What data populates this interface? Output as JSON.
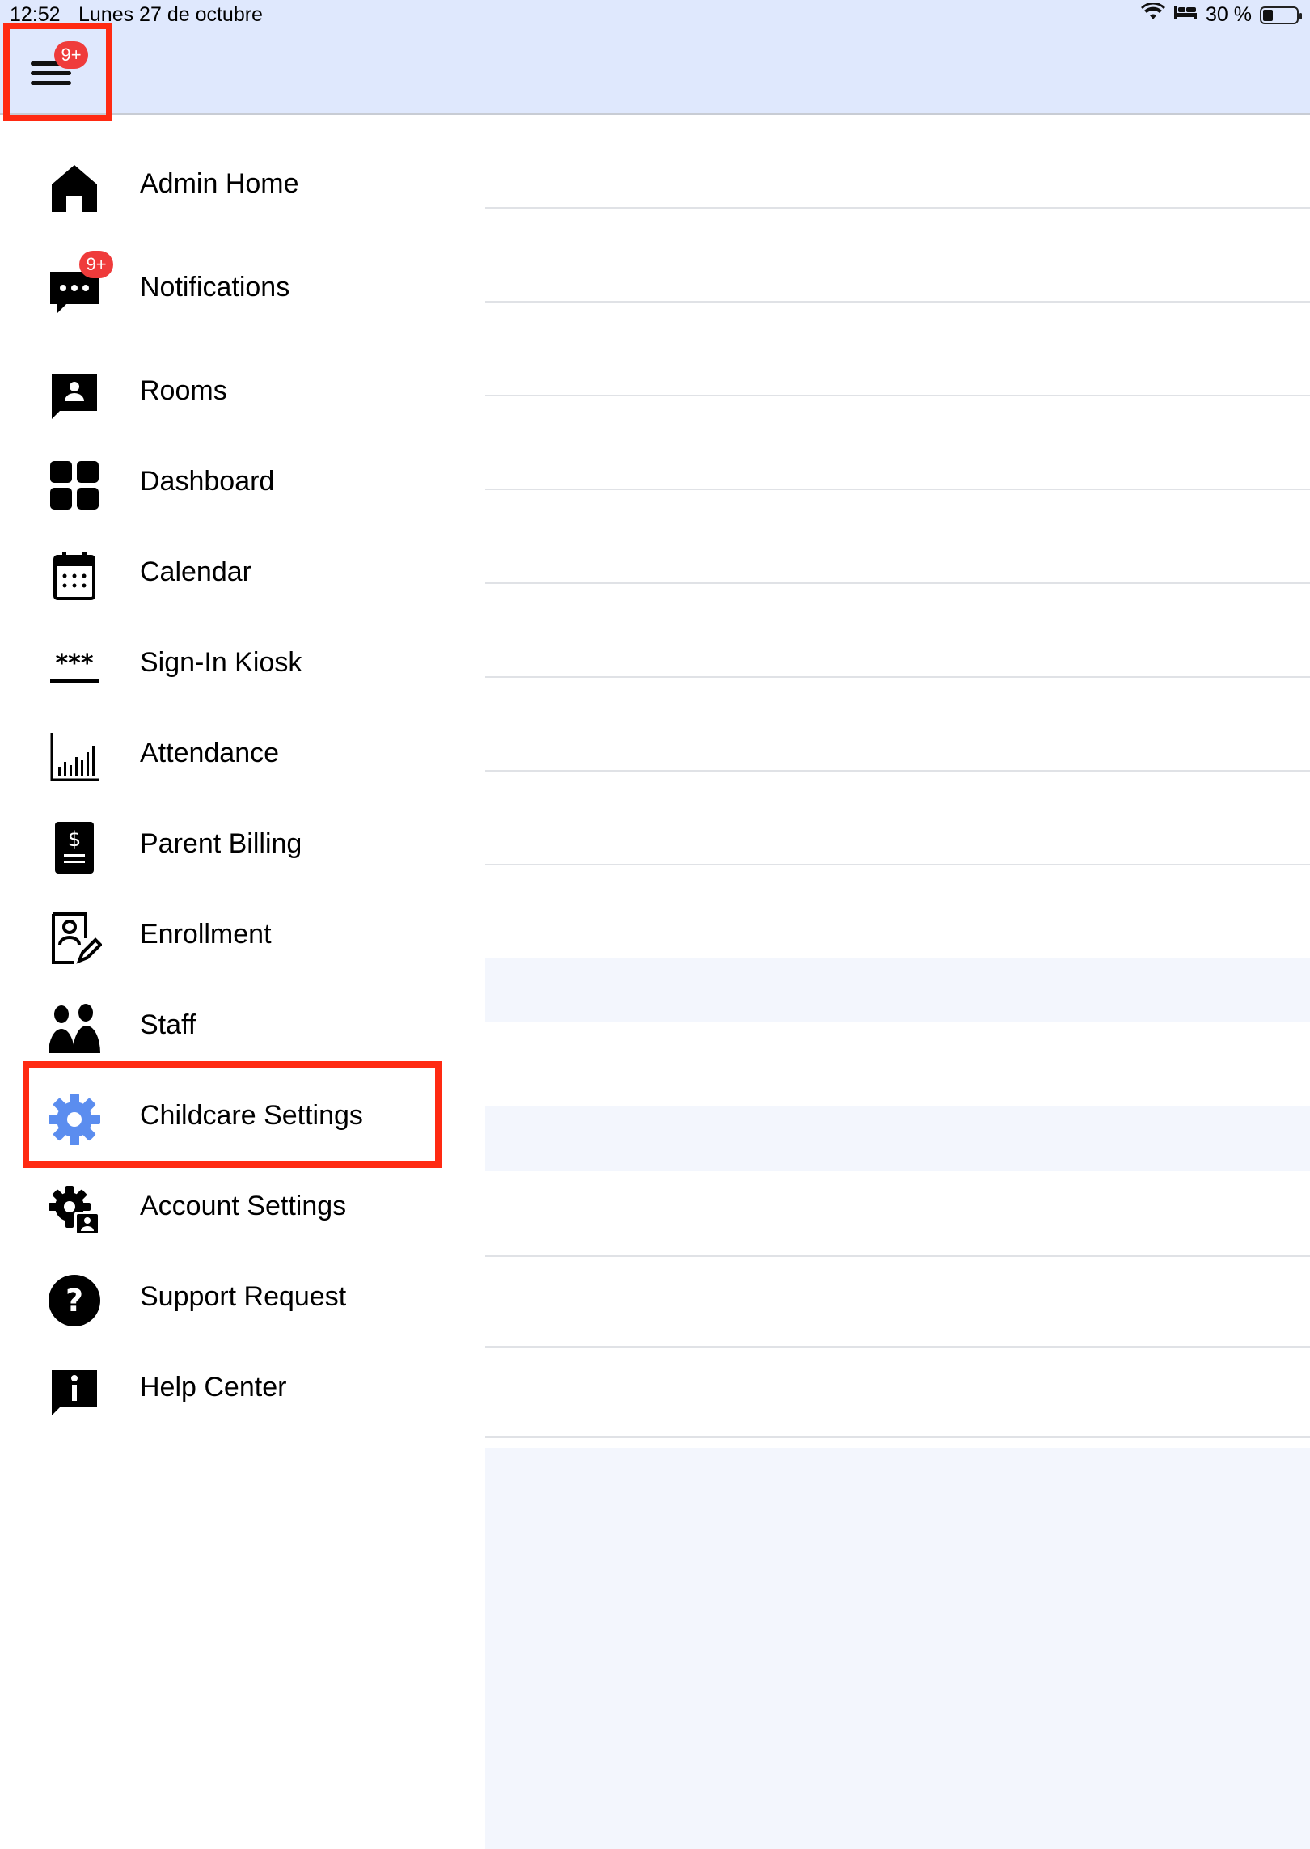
{
  "status_bar": {
    "time": "12:52",
    "date": "Lunes 27 de octubre",
    "battery_text": "30 %",
    "battery_level": 0.3
  },
  "header": {
    "menu_badge": "9+"
  },
  "sidebar": {
    "items": [
      {
        "label": "Admin Home",
        "icon": "home-icon"
      },
      {
        "label": "Notifications",
        "icon": "chat-bubble-icon",
        "badge": "9+"
      },
      {
        "label": "Rooms",
        "icon": "person-card-icon"
      },
      {
        "label": "Dashboard",
        "icon": "grid-icon"
      },
      {
        "label": "Calendar",
        "icon": "calendar-icon"
      },
      {
        "label": "Sign-In Kiosk",
        "icon": "password-icon"
      },
      {
        "label": "Attendance",
        "icon": "bar-chart-icon"
      },
      {
        "label": "Parent Billing",
        "icon": "invoice-icon"
      },
      {
        "label": "Enrollment",
        "icon": "edit-profile-icon"
      },
      {
        "label": "Staff",
        "icon": "people-icon"
      },
      {
        "label": "Childcare Settings",
        "icon": "gear-icon",
        "selected": true
      },
      {
        "label": "Account Settings",
        "icon": "account-gear-icon"
      },
      {
        "label": "Support Request",
        "icon": "help-circle-icon"
      },
      {
        "label": "Help Center",
        "icon": "info-bubble-icon"
      }
    ]
  },
  "colors": {
    "header_bg": "#dfe8fd",
    "badge": "#ef3b3b",
    "highlight": "#ff2a12",
    "active_icon": "#5b8def",
    "shaded_row": "#f3f6fd"
  }
}
